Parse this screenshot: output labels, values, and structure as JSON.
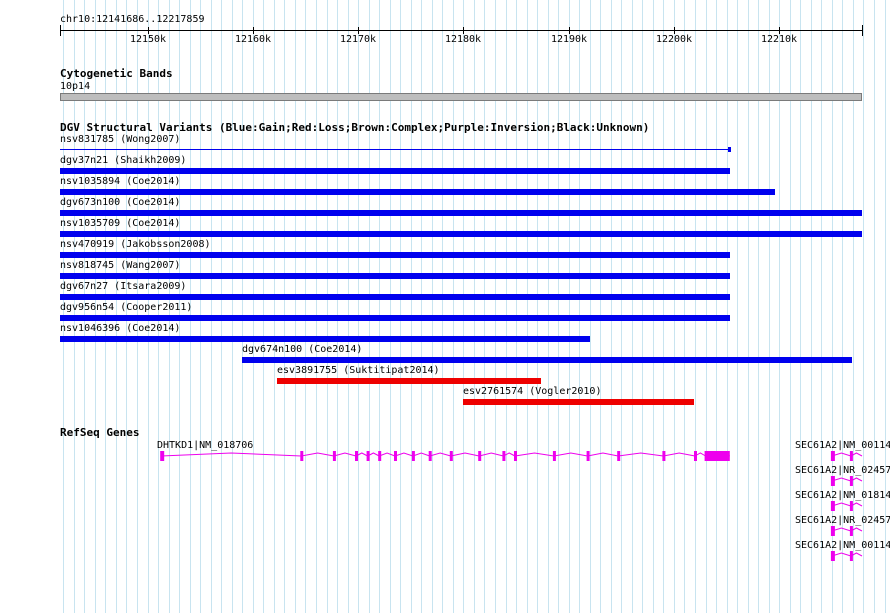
{
  "colors": {
    "gain": "#0000ee",
    "loss": "#ee0000",
    "gene": "#ee00ee",
    "grid": "#c8e4f0"
  },
  "ruler": {
    "location": "chr10:12141686..12217859",
    "ticks": [
      "12150k",
      "12160k",
      "12170k",
      "12180k",
      "12190k",
      "12200k",
      "12210k"
    ]
  },
  "cytobands": {
    "title": "Cytogenetic Bands",
    "band": "10p14"
  },
  "dgv": {
    "title": "DGV Structural Variants (Blue:Gain;Red:Loss;Brown:Complex;Purple:Inversion;Black:Unknown)",
    "variants": [
      {
        "label": "nsv831785 (Wong2007)",
        "start": 12141686,
        "end": 12205200,
        "type": "gain",
        "style": "thin"
      },
      {
        "label": "dgv37n21 (Shaikh2009)",
        "start": 12141686,
        "end": 12205300,
        "type": "gain",
        "style": "bar"
      },
      {
        "label": "nsv1035894 (Coe2014)",
        "start": 12141686,
        "end": 12209600,
        "type": "gain",
        "style": "bar"
      },
      {
        "label": "dgv673n100 (Coe2014)",
        "start": 12141686,
        "end": 12217859,
        "type": "gain",
        "style": "bar"
      },
      {
        "label": "nsv1035709 (Coe2014)",
        "start": 12141686,
        "end": 12217859,
        "type": "gain",
        "style": "bar"
      },
      {
        "label": "nsv470919 (Jakobsson2008)",
        "start": 12141686,
        "end": 12205300,
        "type": "gain",
        "style": "bar"
      },
      {
        "label": "nsv818745 (Wang2007)",
        "start": 12141686,
        "end": 12205300,
        "type": "gain",
        "style": "bar"
      },
      {
        "label": "dgv67n27 (Itsara2009)",
        "start": 12141686,
        "end": 12205300,
        "type": "gain",
        "style": "bar"
      },
      {
        "label": "dgv956n54 (Cooper2011)",
        "start": 12141686,
        "end": 12205300,
        "type": "gain",
        "style": "bar"
      },
      {
        "label": "nsv1046396 (Coe2014)",
        "start": 12141686,
        "end": 12192000,
        "type": "gain",
        "style": "bar"
      },
      {
        "label": "dgv674n100 (Coe2014)",
        "start": 12159000,
        "end": 12216900,
        "type": "gain",
        "style": "bar"
      },
      {
        "label": "esv3891755 (Suktitipat2014)",
        "start": 12162300,
        "end": 12187400,
        "type": "loss",
        "style": "bar"
      },
      {
        "label": "esv2761574 (Vogler2010)",
        "start": 12180000,
        "end": 12201900,
        "type": "loss",
        "style": "bar"
      }
    ]
  },
  "refseq": {
    "title": "RefSeq Genes",
    "genes": [
      {
        "label": "DHTKD1|NM_018706",
        "start": 12151300,
        "end": 12205300,
        "exons": [
          12151300,
          12164600,
          12167700,
          12169800,
          12170900,
          12172000,
          12173500,
          12175200,
          12176800,
          12178800,
          12181500,
          12183800,
          12184900,
          12188600,
          12191800,
          12194700,
          12199000,
          12202000,
          12203000,
          12204000
        ],
        "thick_start": 12203000,
        "thick_end": 12205300
      },
      {
        "label": "SEC61A2|NM_00114",
        "start": 12215000,
        "end": 12218700,
        "exons": [
          12215000,
          12216800
        ]
      },
      {
        "label": "SEC61A2|NR_02457",
        "start": 12215000,
        "end": 12218700,
        "exons": [
          12215000,
          12216800
        ]
      },
      {
        "label": "SEC61A2|NM_01814",
        "start": 12215000,
        "end": 12218700,
        "exons": [
          12215000,
          12216800
        ]
      },
      {
        "label": "SEC61A2|NR_02457",
        "start": 12215000,
        "end": 12218700,
        "exons": [
          12215000,
          12216800
        ]
      },
      {
        "label": "SEC61A2|NM_00114",
        "start": 12215000,
        "end": 12218700,
        "exons": [
          12215000,
          12216800
        ]
      }
    ]
  }
}
